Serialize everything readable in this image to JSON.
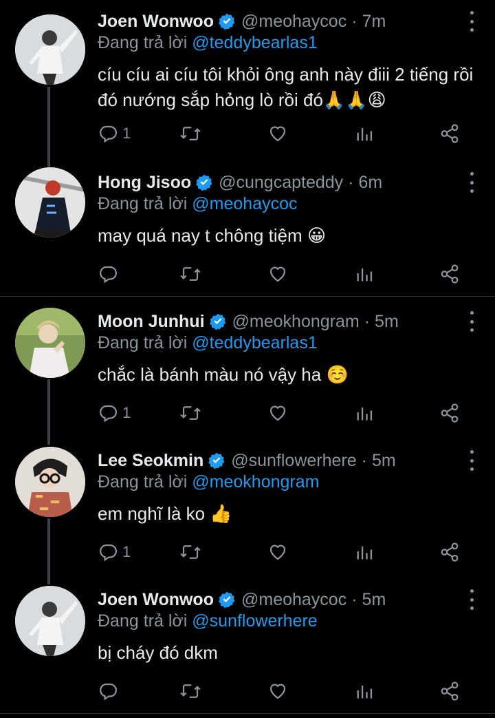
{
  "reply_prefix": "Đang trả lời",
  "tweets": [
    {
      "name": "Joen Wonwoo",
      "handle": "@meohaycoc",
      "separator": "·",
      "time": "7m",
      "reply_to": "@teddybearlas1",
      "text": "cíu cíu ai cíu tôi khỏi ông anh này điii 2 tiếng rồi đó nướng sắp hỏng lò rồi đó🙏🙏😩",
      "reply_count": "1"
    },
    {
      "name": "Hong Jisoo",
      "handle": "@cungcapteddy",
      "separator": "·",
      "time": "6m",
      "reply_to": "@meohaycoc",
      "text": "may quá nay t chông tiệm 😀",
      "reply_count": ""
    },
    {
      "name": "Moon Junhui",
      "handle": "@meokhongram",
      "separator": "·",
      "time": "5m",
      "reply_to": "@teddybearlas1",
      "text": "chắc là bánh màu nó vậy ha ☺️",
      "reply_count": "1"
    },
    {
      "name": "Lee Seokmin",
      "handle": "@sunflowerhere",
      "separator": "·",
      "time": "5m",
      "reply_to": "@meokhongram",
      "text": "em nghĩ là ko 👍",
      "reply_count": "1"
    },
    {
      "name": "Joen Wonwoo",
      "handle": "@meohaycoc",
      "separator": "·",
      "time": "5m",
      "reply_to": "@sunflowerhere",
      "text": "bị cháy đó dkm",
      "reply_count": ""
    }
  ],
  "colors": {
    "background": "#000000",
    "text": "#e7e9ea",
    "muted": "#8b949b",
    "accent": "#1d9bf0",
    "thread_line": "#3d4247",
    "divider": "#2f3336"
  }
}
